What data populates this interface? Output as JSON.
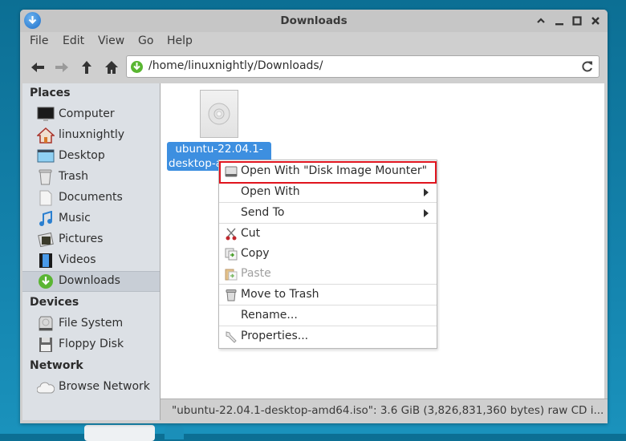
{
  "window": {
    "title": "Downloads",
    "controls": [
      "shade",
      "minimize",
      "maximize",
      "close"
    ]
  },
  "menubar": [
    "File",
    "Edit",
    "View",
    "Go",
    "Help"
  ],
  "toolbar": {
    "address": "/home/linuxnightly/Downloads/"
  },
  "sidebar": {
    "places_title": "Places",
    "places": [
      {
        "label": "Computer",
        "icon": "computer-icon"
      },
      {
        "label": "linuxnightly",
        "icon": "home-icon"
      },
      {
        "label": "Desktop",
        "icon": "desktop-icon"
      },
      {
        "label": "Trash",
        "icon": "trash-icon"
      },
      {
        "label": "Documents",
        "icon": "documents-icon"
      },
      {
        "label": "Music",
        "icon": "music-icon"
      },
      {
        "label": "Pictures",
        "icon": "pictures-icon"
      },
      {
        "label": "Videos",
        "icon": "videos-icon"
      },
      {
        "label": "Downloads",
        "icon": "downloads-icon",
        "active": true
      }
    ],
    "devices_title": "Devices",
    "devices": [
      {
        "label": "File System",
        "icon": "harddisk-icon"
      },
      {
        "label": "Floppy Disk",
        "icon": "floppy-icon"
      }
    ],
    "network_title": "Network",
    "network": [
      {
        "label": "Browse Network",
        "icon": "cloud-icon"
      }
    ]
  },
  "files": [
    {
      "name_line1": "ubuntu-22.04.1-",
      "name_line2": "desktop-a",
      "selected": true,
      "icon": "disc-image-icon"
    }
  ],
  "context_menu": [
    {
      "label": "Open With \"Disk Image Mounter\"",
      "icon": "disk-icon",
      "highlighted": true
    },
    {
      "label": "Open With",
      "submenu": true
    },
    {
      "label": "Send To",
      "submenu": true
    },
    {
      "label": "Cut",
      "icon": "scissors-icon"
    },
    {
      "label": "Copy",
      "icon": "copy-icon"
    },
    {
      "label": "Paste",
      "icon": "paste-icon",
      "disabled": true
    },
    {
      "label": "Move to Trash",
      "icon": "trash-icon"
    },
    {
      "label": "Rename..."
    },
    {
      "label": "Properties...",
      "icon": "properties-icon"
    }
  ],
  "statusbar": {
    "text": "\"ubuntu-22.04.1-desktop-amd64.iso\": 3.6 GiB (3,826,831,360 bytes) raw CD i..."
  },
  "colors": {
    "selection": "#3d8fe0",
    "highlight_border": "#e0141e",
    "desktop_bg": "#1483ad"
  }
}
